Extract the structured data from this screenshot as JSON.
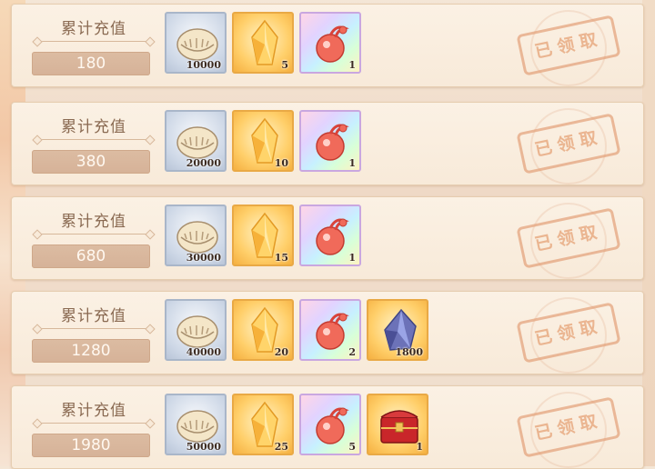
{
  "rows": [
    {
      "title": "累计充值",
      "amount": "180",
      "status": "已领取",
      "items": [
        {
          "icon": "shell-icon",
          "qty": "10000"
        },
        {
          "icon": "gold-crystal-icon",
          "qty": "5"
        },
        {
          "icon": "red-fruit-icon",
          "qty": "1"
        }
      ]
    },
    {
      "title": "累计充值",
      "amount": "380",
      "status": "已领取",
      "items": [
        {
          "icon": "shell-icon",
          "qty": "20000"
        },
        {
          "icon": "gold-crystal-icon",
          "qty": "10"
        },
        {
          "icon": "red-fruit-icon",
          "qty": "1"
        }
      ]
    },
    {
      "title": "累计充值",
      "amount": "680",
      "status": "已领取",
      "items": [
        {
          "icon": "shell-icon",
          "qty": "30000"
        },
        {
          "icon": "gold-crystal-icon",
          "qty": "15"
        },
        {
          "icon": "red-fruit-icon",
          "qty": "1"
        }
      ]
    },
    {
      "title": "累计充值",
      "amount": "1280",
      "status": "已领取",
      "items": [
        {
          "icon": "shell-icon",
          "qty": "40000"
        },
        {
          "icon": "gold-crystal-icon",
          "qty": "20"
        },
        {
          "icon": "red-fruit-icon",
          "qty": "2"
        },
        {
          "icon": "blue-gem-icon",
          "qty": "1800"
        }
      ]
    },
    {
      "title": "累计充值",
      "amount": "1980",
      "status": "已领取",
      "items": [
        {
          "icon": "shell-icon",
          "qty": "50000"
        },
        {
          "icon": "gold-crystal-icon",
          "qty": "25"
        },
        {
          "icon": "red-fruit-icon",
          "qty": "5"
        },
        {
          "icon": "red-chest-icon",
          "qty": "1"
        }
      ]
    }
  ]
}
